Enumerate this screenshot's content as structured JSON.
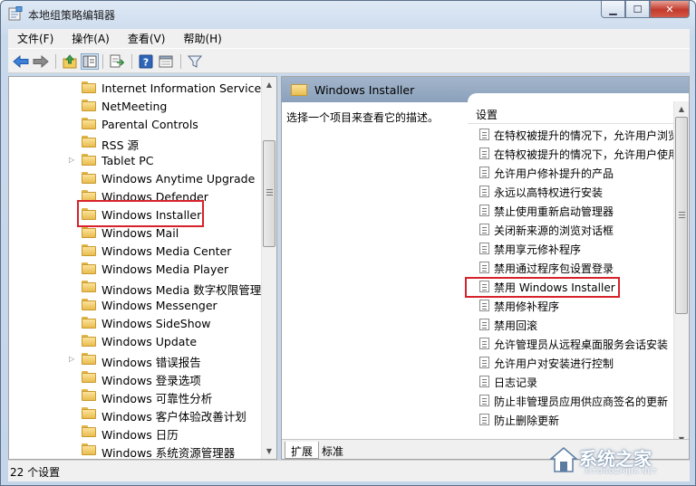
{
  "window": {
    "title": "本地组策略编辑器"
  },
  "caption_buttons": {
    "minimize": "▁",
    "maximize": "☐",
    "close": "✕"
  },
  "menu": [
    {
      "label": "文件(F)"
    },
    {
      "label": "操作(A)"
    },
    {
      "label": "查看(V)"
    },
    {
      "label": "帮助(H)"
    }
  ],
  "toolbar": {
    "buttons": [
      "back-arrow-icon",
      "forward-arrow-icon",
      "up-folder-icon",
      "show-hide-tree-icon",
      "export-list-icon",
      "help-icon",
      "console-icon",
      "filter-icon"
    ]
  },
  "tree": {
    "items": [
      {
        "label": "Internet Information Services",
        "expandable": false
      },
      {
        "label": "NetMeeting",
        "expandable": false
      },
      {
        "label": "Parental Controls",
        "expandable": false
      },
      {
        "label": "RSS 源",
        "expandable": false
      },
      {
        "label": "Tablet PC",
        "expandable": true
      },
      {
        "label": "Windows Anytime Upgrade",
        "expandable": false
      },
      {
        "label": "Windows Defender",
        "expandable": false
      },
      {
        "label": "Windows Installer",
        "expandable": false,
        "selected": true
      },
      {
        "label": "Windows Mail",
        "expandable": false
      },
      {
        "label": "Windows Media Center",
        "expandable": false
      },
      {
        "label": "Windows Media Player",
        "expandable": false
      },
      {
        "label": "Windows Media 数字权限管理",
        "expandable": false
      },
      {
        "label": "Windows Messenger",
        "expandable": false
      },
      {
        "label": "Windows SideShow",
        "expandable": false
      },
      {
        "label": "Windows Update",
        "expandable": false
      },
      {
        "label": "Windows 错误报告",
        "expandable": true
      },
      {
        "label": "Windows 登录选项",
        "expandable": false
      },
      {
        "label": "Windows 可靠性分析",
        "expandable": false
      },
      {
        "label": "Windows 客户体验改善计划",
        "expandable": false
      },
      {
        "label": "Windows 日历",
        "expandable": false
      },
      {
        "label": "Windows 系统资源管理器",
        "expandable": false
      }
    ]
  },
  "right_pane": {
    "header_title": "Windows Installer",
    "description": "选择一个项目来查看它的描述。",
    "column_header": "设置",
    "settings": [
      {
        "label": "在特权被提升的情况下，允许用户浏览"
      },
      {
        "label": "在特权被提升的情况下，允许用户使用"
      },
      {
        "label": "允许用户修补提升的产品"
      },
      {
        "label": "永远以高特权进行安装"
      },
      {
        "label": "禁止使用重新启动管理器"
      },
      {
        "label": "关闭新来源的浏览对话框"
      },
      {
        "label": "禁用享元修补程序"
      },
      {
        "label": "禁用通过程序包设置登录"
      },
      {
        "label": "禁用 Windows Installer",
        "highlighted": true
      },
      {
        "label": "禁用修补程序"
      },
      {
        "label": "禁用回滚"
      },
      {
        "label": "允许管理员从远程桌面服务会话安装"
      },
      {
        "label": "允许用户对安装进行控制"
      },
      {
        "label": "日志记录"
      },
      {
        "label": "防止非管理员应用供应商签名的更新"
      },
      {
        "label": "防止删除更新"
      }
    ],
    "tabs": [
      {
        "label": "扩展",
        "active": true
      },
      {
        "label": "标准",
        "active": false
      }
    ]
  },
  "status": {
    "text": "22 个设置"
  },
  "watermark": {
    "text": "系统之家",
    "sub": "XITONGZHIJIA.NET"
  }
}
